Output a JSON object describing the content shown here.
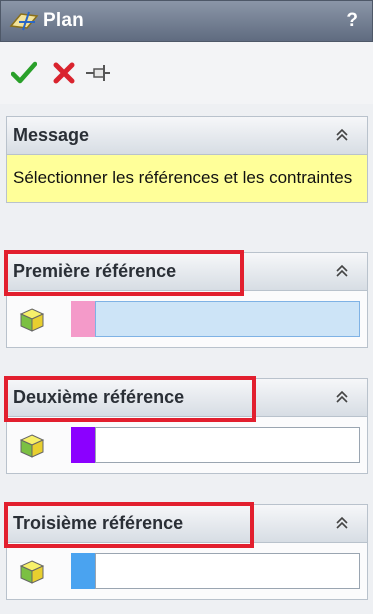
{
  "window": {
    "title": "Plan",
    "help_label": "?",
    "title_icon": "plane-feature-icon"
  },
  "toolbar": {
    "buttons": [
      {
        "name": "ok-button",
        "icon": "checkmark-icon",
        "color": "#2aa02a"
      },
      {
        "name": "cancel-button",
        "icon": "x-icon",
        "color": "#d9232e"
      },
      {
        "name": "pushpin-button",
        "icon": "pushpin-icon",
        "color": "#555555"
      }
    ]
  },
  "message": {
    "title": "Message",
    "text": "Sélectionner les références et les contraintes",
    "background": "#ffff99"
  },
  "references": [
    {
      "title": "Première référence",
      "swatch_color": "#f49ac9",
      "active": true,
      "value": ""
    },
    {
      "title": "Deuxième référence",
      "swatch_color": "#8b00ff",
      "active": false,
      "value": ""
    },
    {
      "title": "Troisième référence",
      "swatch_color": "#4aa3f0",
      "active": false,
      "value": ""
    }
  ],
  "highlight_color": "#e21f2e",
  "accent": {
    "titlebar": "#6d788b",
    "active_field": "#cde4f7"
  }
}
